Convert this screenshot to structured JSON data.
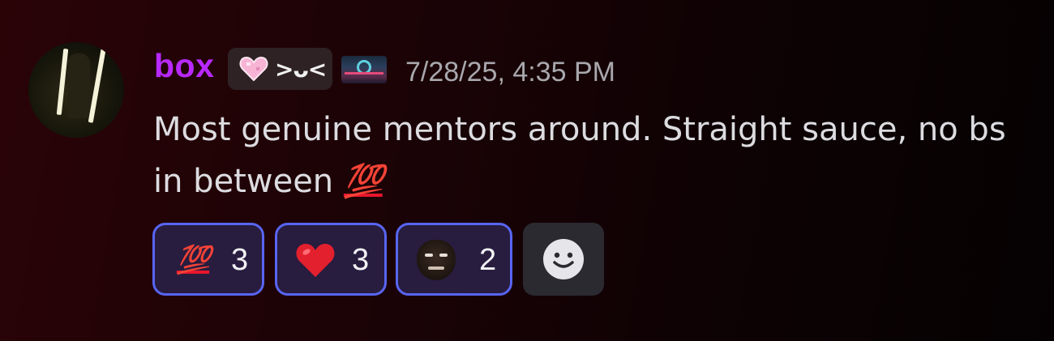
{
  "message": {
    "username": "box",
    "user_color": "#b829ff",
    "server_tag": {
      "icon": "pink-heart-icon",
      "text": ">ᴗ<"
    },
    "badge_icon": "server-badge-icon",
    "timestamp": "7/28/25, 4:35 PM",
    "content": "Most genuine mentors around. Straight sauce, no bs in between",
    "content_emoji": "💯"
  },
  "reactions": [
    {
      "emoji": "💯",
      "icon": "hundred-points-icon",
      "count": "3"
    },
    {
      "emoji": "❤️",
      "icon": "red-heart-icon",
      "count": "3"
    },
    {
      "emoji": "custom",
      "icon": "custom-face-emoji-icon",
      "count": "2"
    }
  ],
  "add_reaction_icon": "add-reaction-smiley-icon",
  "colors": {
    "reaction_border": "#5865f2",
    "reaction_bg": "#281c3f",
    "text": "#dcdce0",
    "timestamp": "#a8a8ad"
  }
}
